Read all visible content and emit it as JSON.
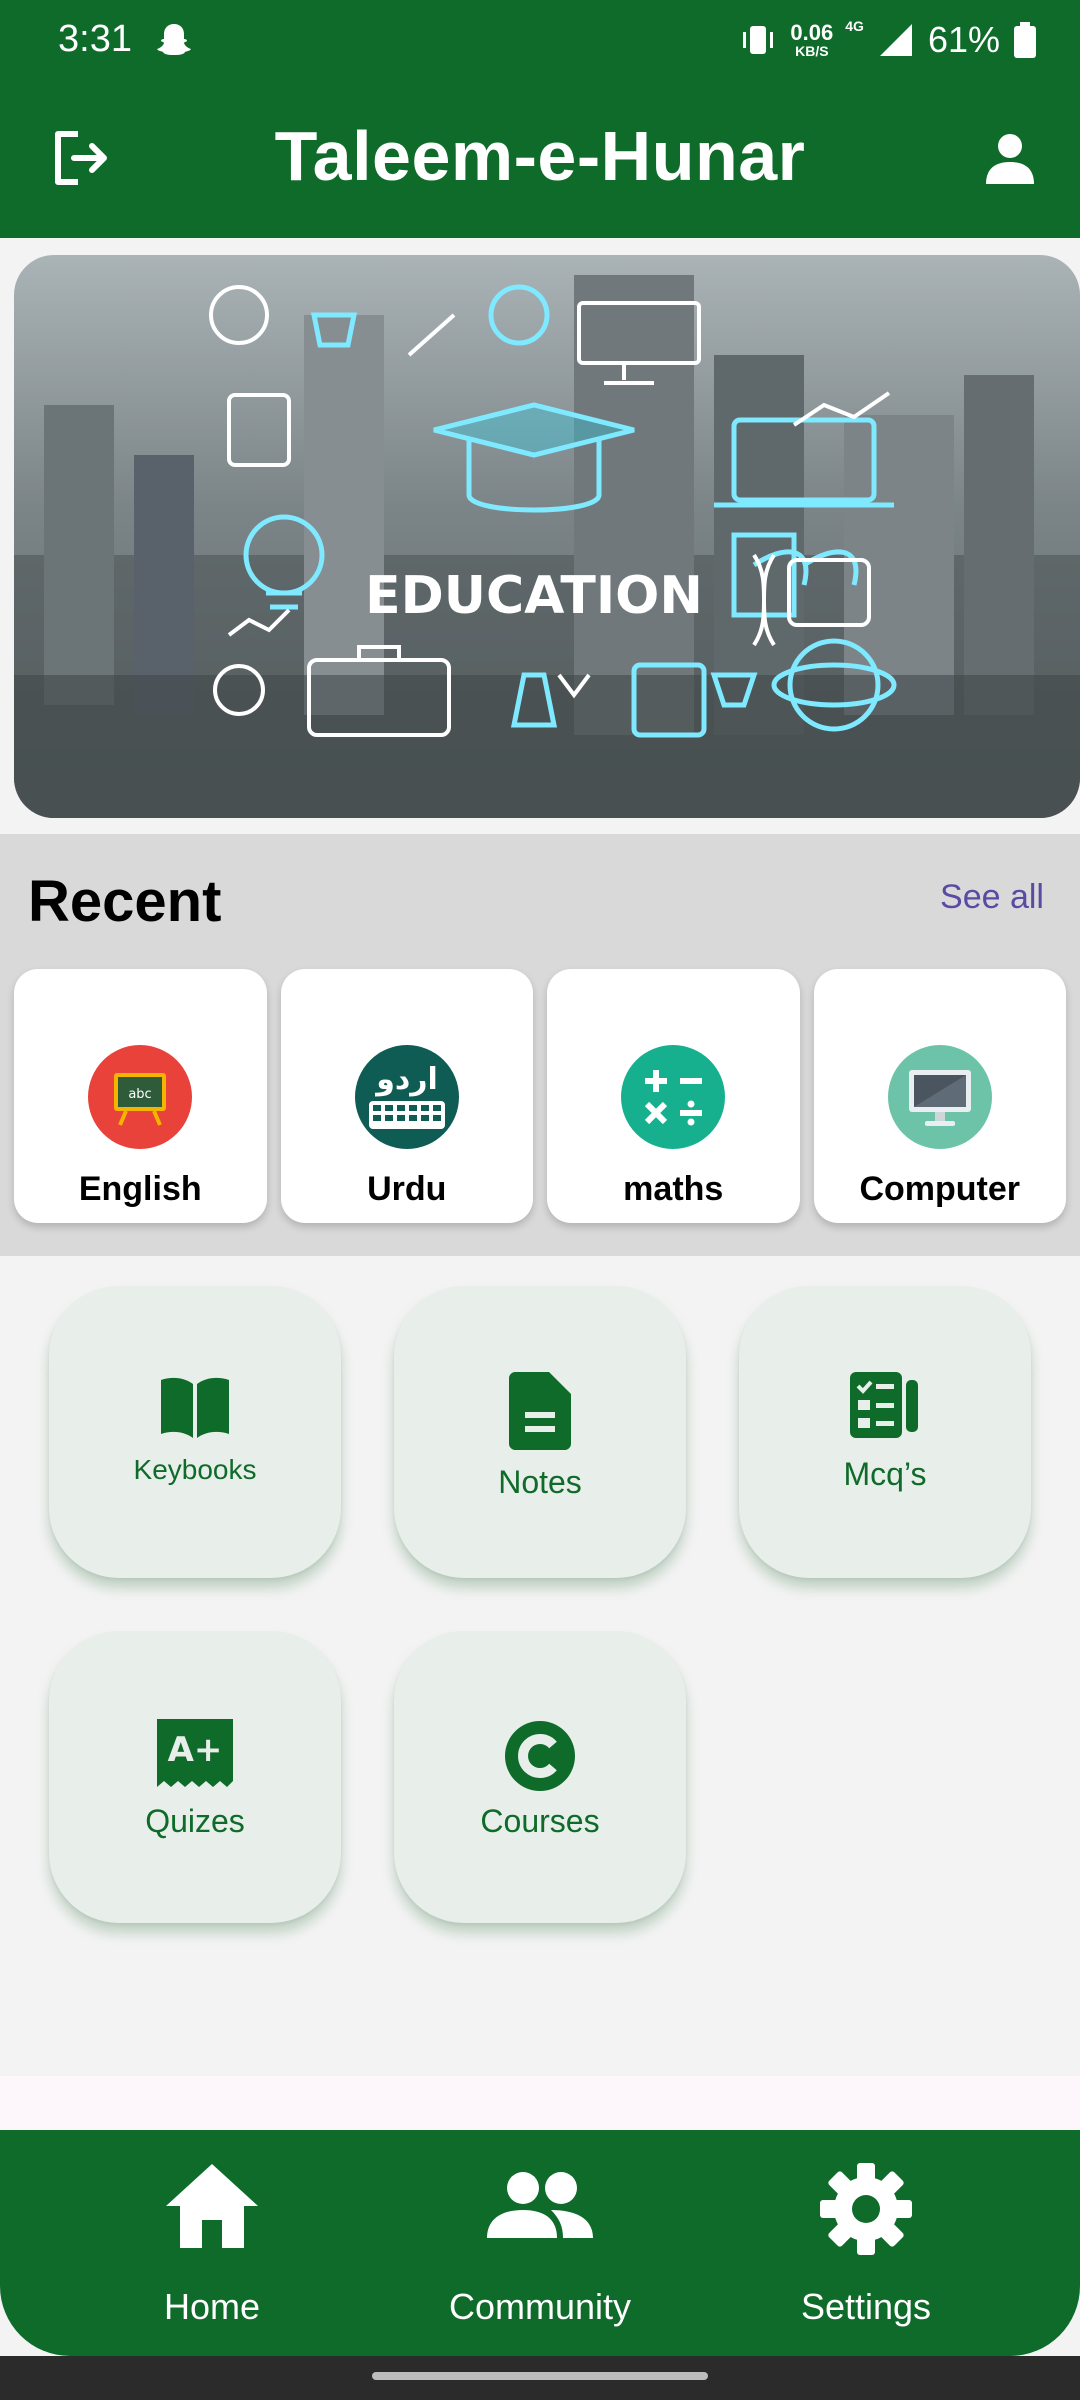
{
  "status_bar": {
    "time": "3:31",
    "net_speed": "0.06",
    "net_unit": "KB/S",
    "network": "4G",
    "battery": "61%"
  },
  "app_bar": {
    "title": "Taleem-e-Hunar",
    "left_icon": "logout-icon",
    "right_icon": "person-icon"
  },
  "banner": {
    "text": "EDUCATION"
  },
  "recent": {
    "title": "Recent",
    "see_all": "See all",
    "items": [
      {
        "label": "English",
        "icon": "chalkboard-icon",
        "color": "#e8423a"
      },
      {
        "label": "Urdu",
        "icon": "urdu-keyboard-icon",
        "color": "#0f5c55",
        "badge": "اردو"
      },
      {
        "label": "maths",
        "icon": "math-operators-icon",
        "color": "#16b08f"
      },
      {
        "label": "Computer",
        "icon": "monitor-icon",
        "color": "#6cc3a8"
      }
    ]
  },
  "features": [
    {
      "label": "Keybooks",
      "icon": "open-book-icon"
    },
    {
      "label": "Notes",
      "icon": "note-document-icon"
    },
    {
      "label": "Mcq’s",
      "icon": "checklist-icon"
    },
    {
      "label": "Quizes",
      "icon": "a-plus-icon",
      "badge": "A+"
    },
    {
      "label": "Courses",
      "icon": "c-logo-icon"
    }
  ],
  "bottom_nav": [
    {
      "label": "Home",
      "icon": "home-icon"
    },
    {
      "label": "Community",
      "icon": "people-icon"
    },
    {
      "label": "Settings",
      "icon": "gear-icon"
    }
  ],
  "colors": {
    "primary": "#0f6b2a",
    "accent": "#5b4aa3"
  }
}
